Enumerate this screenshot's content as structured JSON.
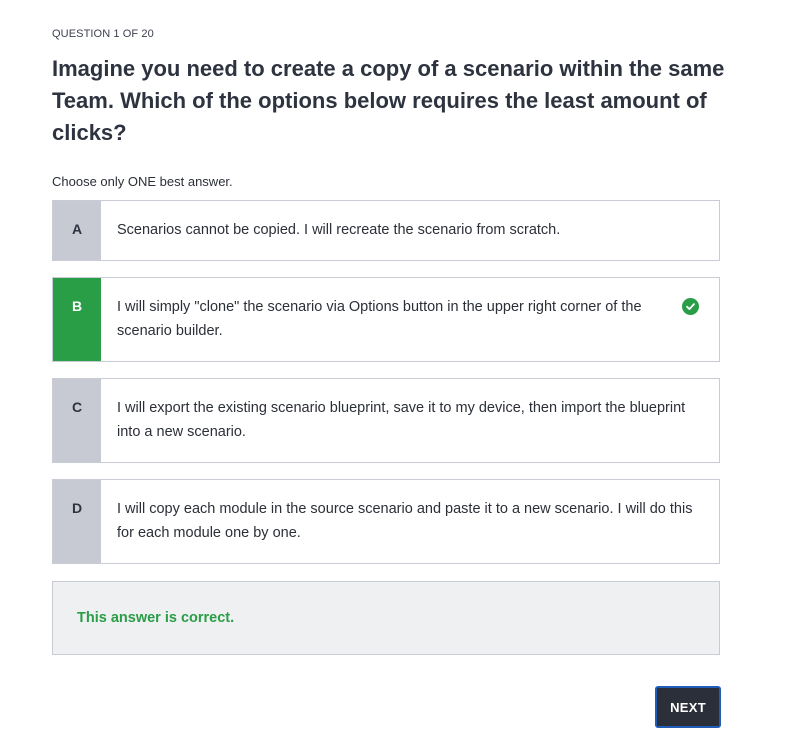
{
  "quiz": {
    "question_counter": "QUESTION 1 OF 20",
    "question_text": "Imagine you need to create a copy of a scenario within the same Team. Which of the options below requires the least amount of clicks?",
    "instruction": "Choose only ONE best answer.",
    "options": [
      {
        "letter": "A",
        "text": "Scenarios cannot be copied. I will recreate the scenario from scratch.",
        "state": "unselected"
      },
      {
        "letter": "B",
        "text": "I will simply \"clone\" the scenario via Options button in the upper right corner of the scenario builder.",
        "state": "correct"
      },
      {
        "letter": "C",
        "text": "I will export the existing scenario blueprint, save it to my device, then import the blueprint into a new scenario.",
        "state": "unselected"
      },
      {
        "letter": "D",
        "text": "I will copy each module in the source scenario and paste it to a new scenario. I will do this for each module one by one.",
        "state": "unselected"
      }
    ],
    "feedback": "This answer is correct.",
    "next_label": "NEXT"
  },
  "icons": {
    "correct_indicator": "check-circle-icon"
  },
  "colors": {
    "correct_green": "#2a9d47",
    "letter_gray": "#c8cad3",
    "button_dark": "#2b2f3a",
    "focus_blue": "#1f5db8",
    "feedback_bg": "#eef0f2"
  }
}
